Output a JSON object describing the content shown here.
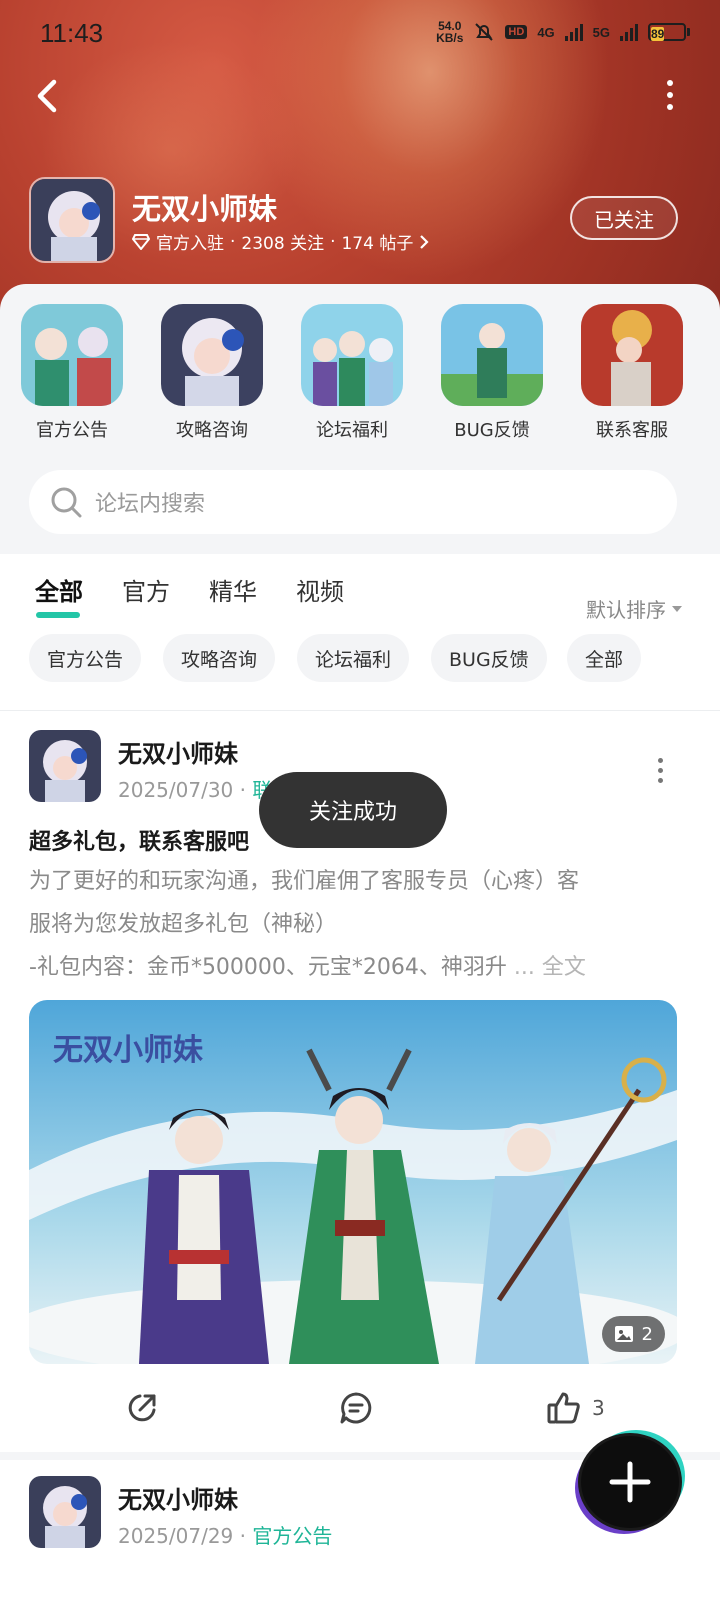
{
  "status_bar": {
    "time": "11:43",
    "net_speed_value": "54.0",
    "net_speed_unit": "KB/s",
    "hd_label": "HD",
    "network_1": "4G",
    "network_2": "5G",
    "battery": "89"
  },
  "forum": {
    "name": "无双小师妹",
    "badge": "官方入驻",
    "followers": "2308 关注",
    "posts": "174 帖子",
    "follow_label": "已关注",
    "icons": {
      "back": "back-arrow-icon",
      "more": "more-vertical-icon",
      "badge": "diamond-icon"
    }
  },
  "shortcuts": [
    {
      "label": "官方公告"
    },
    {
      "label": "攻略咨询"
    },
    {
      "label": "论坛福利"
    },
    {
      "label": "BUG反馈"
    },
    {
      "label": "联系客服"
    }
  ],
  "search": {
    "placeholder": "论坛内搜索"
  },
  "tabs": [
    {
      "label": "全部",
      "active": true
    },
    {
      "label": "官方"
    },
    {
      "label": "精华"
    },
    {
      "label": "视频"
    }
  ],
  "sort": {
    "label": "默认排序"
  },
  "chips": [
    "官方公告",
    "攻略咨询",
    "论坛福利",
    "BUG反馈",
    "全部"
  ],
  "posts": [
    {
      "author": "无双小师妹",
      "date": "2025/07/30",
      "tag_visible": "联",
      "title": "超多礼包，联系客服吧",
      "body_line1": "为了更好的和玩家沟通，我们雇佣了客服专员（心疼）客",
      "body_line2": "服将为您发放超多礼包（神秘）",
      "body_line3": "-礼包内容：金币*500000、元宝*2064、神羽升",
      "more_text": "... 全文",
      "image_logo": "无双小师妹",
      "image_count": "2",
      "likes": "3"
    },
    {
      "author": "无双小师妹",
      "date": "2025/07/29",
      "tag": "官方公告"
    }
  ],
  "toast": "关注成功",
  "colors": {
    "accent": "#23c6a7",
    "header": "#b8412f"
  }
}
